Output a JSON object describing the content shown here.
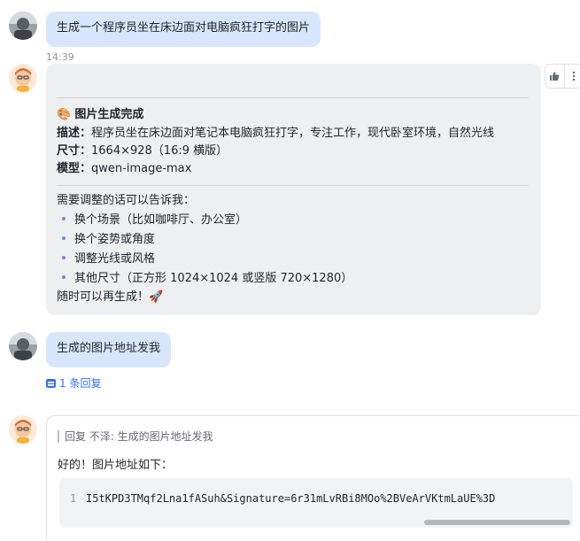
{
  "messages": {
    "user1": {
      "text": "生成一个程序员坐在床边面对电脑疯狂打字的图片"
    },
    "timestamp": "14:39",
    "bot1": {
      "title_icon": "🎨",
      "title": "图片生成完成",
      "desc_label": "描述：",
      "desc_value": "程序员坐在床边面对笔记本电脑疯狂打字，专注工作，现代卧室环境，自然光线",
      "size_label": "尺寸：",
      "size_value": "1664×928（16:9 横版）",
      "model_label": "模型：",
      "model_value": "qwen-image-max",
      "adjust_intro": "需要调整的话可以告诉我：",
      "bullets": [
        "换个场景（比如咖啡厅、办公室）",
        "换个姿势或角度",
        "调整光线或风格",
        "其他尺寸（正方形 1024×1024 或竖版 720×1280）"
      ],
      "closing": "随时可以再生成！🚀"
    },
    "user2": {
      "text": "生成的图片地址发我"
    },
    "reply_count": "1 条回复",
    "bot2": {
      "quote": "回复 不泽: 生成的图片地址发我",
      "text": "好的！图片地址如下：",
      "code_line_number": "1",
      "code": "I5tKPD3TMqf2Lna1fASuh&Signature=6r31mLvRBi8MOo%2BVeArVKtmLaUE%3D"
    }
  },
  "icons": {
    "thumbs_up": "thumbs-up-icon",
    "more": "more-icon",
    "reply": "reply-thread-icon"
  },
  "colors": {
    "user_bubble": "#d8e6fd",
    "bot_bubble": "#eeeff1",
    "link": "#3370ff"
  }
}
